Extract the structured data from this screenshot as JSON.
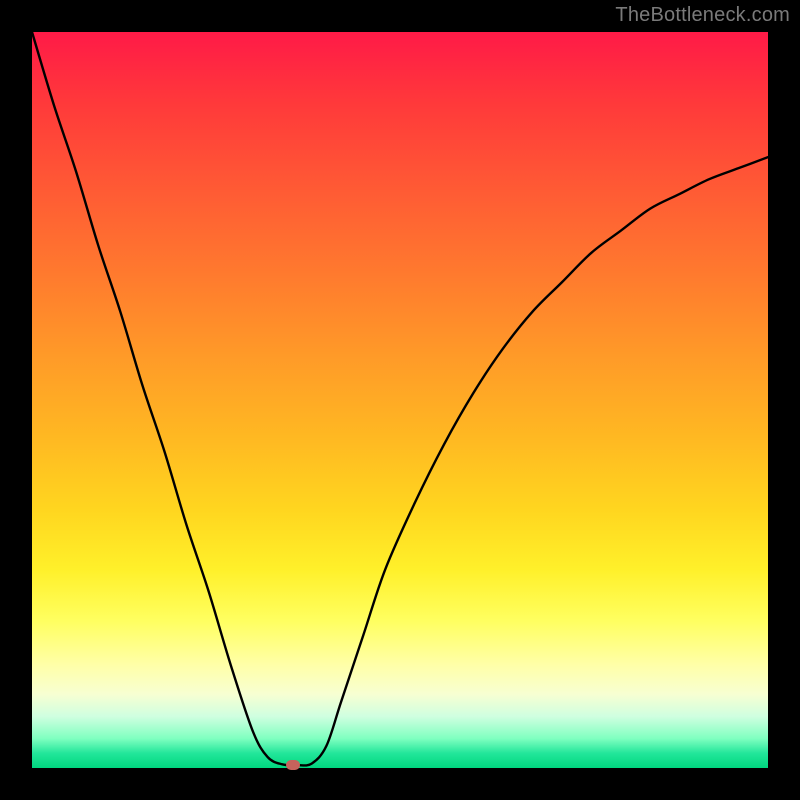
{
  "watermark": "TheBottleneck.com",
  "colors": {
    "frame": "#000000",
    "curve": "#000000",
    "marker": "#c6635c",
    "gradient_stops": [
      "#ff1a47",
      "#ff3a3a",
      "#ff5c34",
      "#ff7a2e",
      "#ff9a28",
      "#ffb822",
      "#ffd61f",
      "#fff02a",
      "#ffff60",
      "#ffffa8",
      "#f7ffd2",
      "#cfffe0",
      "#7fffc0",
      "#22e69a",
      "#00d77f"
    ]
  },
  "chart_data": {
    "type": "line",
    "title": "",
    "xlabel": "",
    "ylabel": "",
    "xlim": [
      0,
      1
    ],
    "ylim": [
      0,
      1
    ],
    "note": "Axes are unlabeled in the image; values are normalized fractions of the plot area. y = vertical position of the black curve measured from bottom (0) to top (1).",
    "series": [
      {
        "name": "curve",
        "x": [
          0.0,
          0.03,
          0.06,
          0.09,
          0.12,
          0.15,
          0.18,
          0.21,
          0.24,
          0.27,
          0.3,
          0.32,
          0.34,
          0.36,
          0.38,
          0.4,
          0.42,
          0.45,
          0.48,
          0.52,
          0.56,
          0.6,
          0.64,
          0.68,
          0.72,
          0.76,
          0.8,
          0.84,
          0.88,
          0.92,
          0.96,
          1.0
        ],
        "y": [
          1.0,
          0.9,
          0.81,
          0.71,
          0.62,
          0.52,
          0.43,
          0.33,
          0.24,
          0.14,
          0.05,
          0.015,
          0.005,
          0.004,
          0.006,
          0.03,
          0.09,
          0.18,
          0.27,
          0.36,
          0.44,
          0.51,
          0.57,
          0.62,
          0.66,
          0.7,
          0.73,
          0.76,
          0.78,
          0.8,
          0.815,
          0.83
        ]
      }
    ],
    "marker": {
      "x": 0.355,
      "y": 0.004
    }
  }
}
